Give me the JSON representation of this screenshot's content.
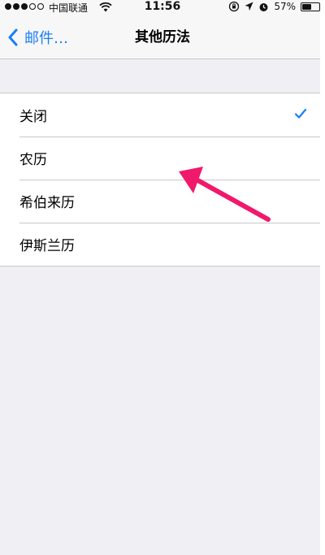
{
  "status_bar": {
    "carrier": "中国联通",
    "time": "11:56",
    "battery": "57%",
    "battery_level": 0.57,
    "signal_bars_filled": 3,
    "signal_bars_total": 5
  },
  "nav": {
    "back_label": "邮件…",
    "title": "其他历法"
  },
  "options": [
    {
      "label": "关闭",
      "selected": true
    },
    {
      "label": "农历",
      "selected": false
    },
    {
      "label": "希伯来历",
      "selected": false
    },
    {
      "label": "伊斯兰历",
      "selected": false
    }
  ],
  "colors": {
    "accent": "#1a7ef5",
    "annotation": "#f0196b",
    "background": "#efeff4"
  },
  "icons": {
    "back": "chevron-left-icon",
    "check": "checkmark-icon",
    "wifi": "wifi-icon",
    "orientation_lock": "orientation-lock-icon",
    "location": "location-arrow-icon",
    "alarm": "alarm-icon"
  }
}
